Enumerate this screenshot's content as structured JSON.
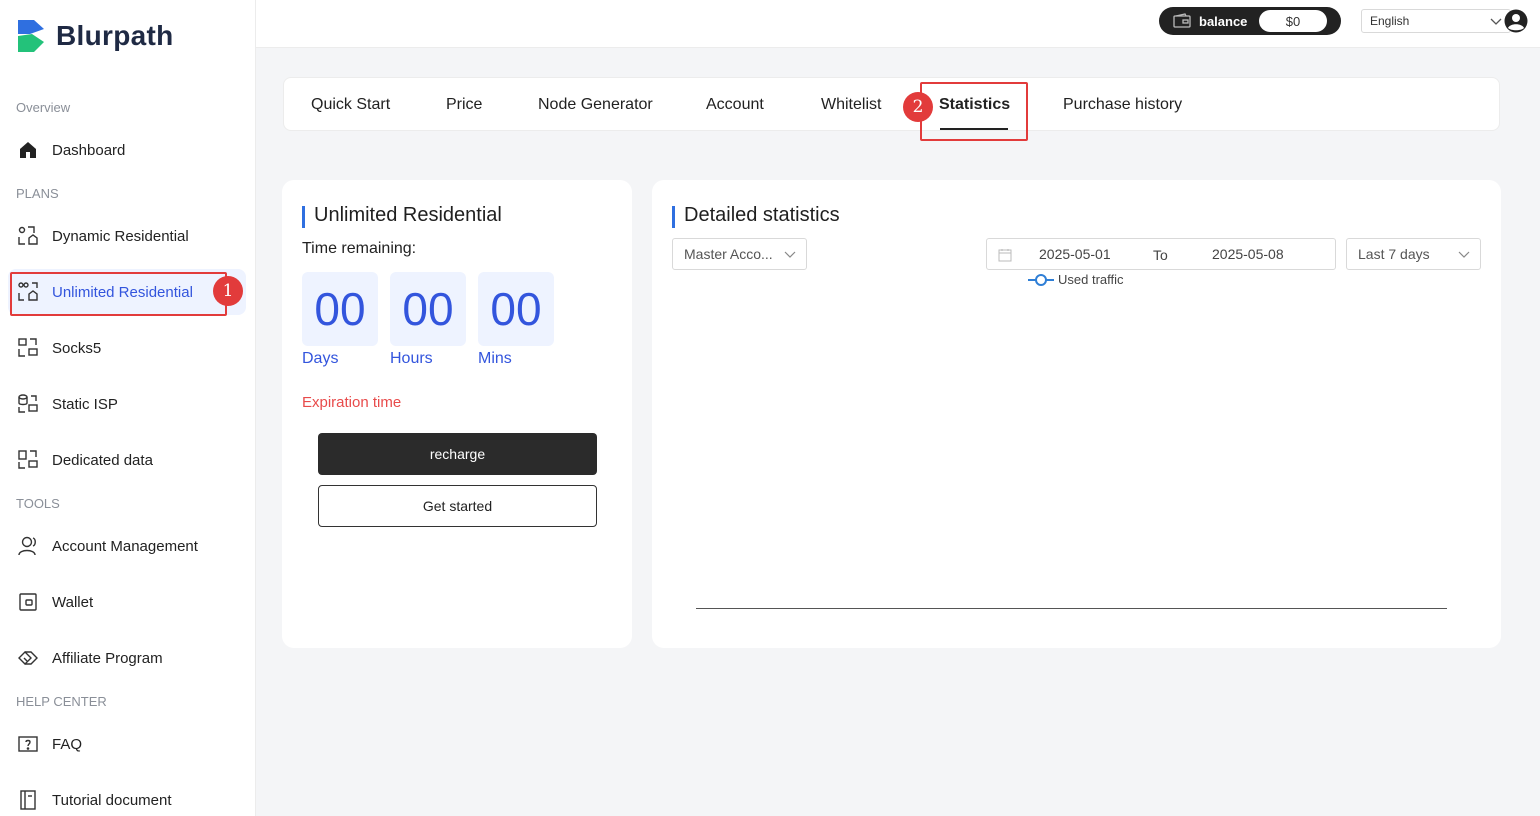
{
  "brand": {
    "name": "Blurpath"
  },
  "header": {
    "balance_label": "balance",
    "balance_value": "$0",
    "language": "English"
  },
  "sidebar": {
    "sections": {
      "overview": "Overview",
      "plans": "PLANS",
      "tools": "TOOLS",
      "help": "HELP CENTER"
    },
    "items": {
      "dashboard": "Dashboard",
      "dynamic": "Dynamic Residential",
      "unlimited": "Unlimited Residential",
      "socks5": "Socks5",
      "static_isp": "Static ISP",
      "dedicated": "Dedicated data",
      "account_mgmt": "Account Management",
      "wallet": "Wallet",
      "affiliate": "Affiliate Program",
      "faq": "FAQ",
      "tutorial": "Tutorial document"
    }
  },
  "tabs": [
    "Quick Start",
    "Price",
    "Node Generator",
    "Account",
    "Whitelist",
    "Statistics",
    "Purchase history"
  ],
  "steps": {
    "one": "1",
    "two": "2"
  },
  "plan_card": {
    "title": "Unlimited Residential",
    "time_remaining_label": "Time remaining:",
    "days": "00",
    "hours": "00",
    "mins": "00",
    "days_label": "Days",
    "hours_label": "Hours",
    "mins_label": "Mins",
    "expiration_label": "Expiration time",
    "recharge_label": "recharge",
    "get_started_label": "Get started"
  },
  "stats_card": {
    "title": "Detailed statistics",
    "account_select": "Master Acco...",
    "date_from": "2025-05-01",
    "date_to_label": "To",
    "date_to": "2025-05-08",
    "range_select": "Last 7 days",
    "legend": "Used traffic"
  },
  "colors": {
    "accent": "#3355dd",
    "annotation_red": "#e23b3b",
    "title_bar": "#2f6fe0"
  }
}
